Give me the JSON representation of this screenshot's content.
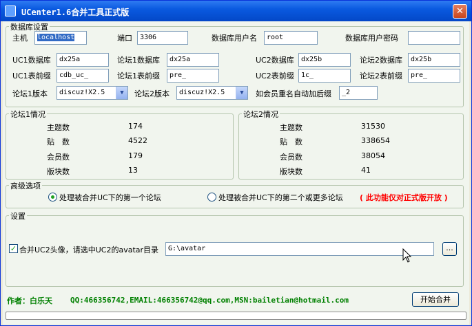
{
  "window": {
    "title": "UCenter1.6合并工具正式版",
    "close_glyph": "✕"
  },
  "db": {
    "group_label": "数据库设置",
    "host_label": "主机",
    "host_value": "localhost",
    "port_label": "端口",
    "port_value": "3306",
    "user_label": "数据库用户名",
    "user_value": "root",
    "pass_label": "数据库用户密码",
    "pass_value": "",
    "uc1db_label": "UC1数据库",
    "uc1db_value": "dx25a",
    "f1db_label": "论坛1数据库",
    "f1db_value": "dx25a",
    "uc2db_label": "UC2数据库",
    "uc2db_value": "dx25b",
    "f2db_label": "论坛2数据库",
    "f2db_value": "dx25b",
    "uc1pre_label": "UC1表前缀",
    "uc1pre_value": "cdb_uc_",
    "f1pre_label": "论坛1表前缀",
    "f1pre_value": "pre_",
    "uc2pre_label": "UC2表前缀",
    "uc2pre_value": "1c_",
    "f2pre_label": "论坛2表前缀",
    "f2pre_value": "pre_",
    "f1ver_label": "论坛1版本",
    "f1ver_value": "discuz!X2.5",
    "f2ver_label": "论坛2版本",
    "f2ver_value": "discuz!X2.5",
    "suffix_label": "如会员重名自动加后缀",
    "suffix_value": "_2"
  },
  "forum1": {
    "group_label": "论坛1情况",
    "rows": [
      {
        "label": "主题数",
        "value": "174"
      },
      {
        "label": "贴　数",
        "value": "4522"
      },
      {
        "label": "会员数",
        "value": "179"
      },
      {
        "label": "版块数",
        "value": "13"
      }
    ]
  },
  "forum2": {
    "group_label": "论坛2情况",
    "rows": [
      {
        "label": "主题数",
        "value": "31530"
      },
      {
        "label": "贴　数",
        "value": "338654"
      },
      {
        "label": "会员数",
        "value": "38054"
      },
      {
        "label": "版块数",
        "value": "41"
      }
    ]
  },
  "advanced": {
    "group_label": "高级选项",
    "option1": "处理被合并UC下的第一个论坛",
    "option2": "处理被合并UC下的第二个或更多论坛",
    "note": "( 此功能仅对正式版开放 )"
  },
  "settings": {
    "group_label": "设置",
    "avatar_label": "合并UC2头像，请选中UC2的avatar目录",
    "avatar_value": "G:\\avatar",
    "browse_label": "..."
  },
  "footer": {
    "author": "作者：白乐天",
    "contact": "QQ:466356742,EMAIL:466356742@qq.com,MSN:bailetian@hotmail.com",
    "start_label": "开始合并"
  }
}
